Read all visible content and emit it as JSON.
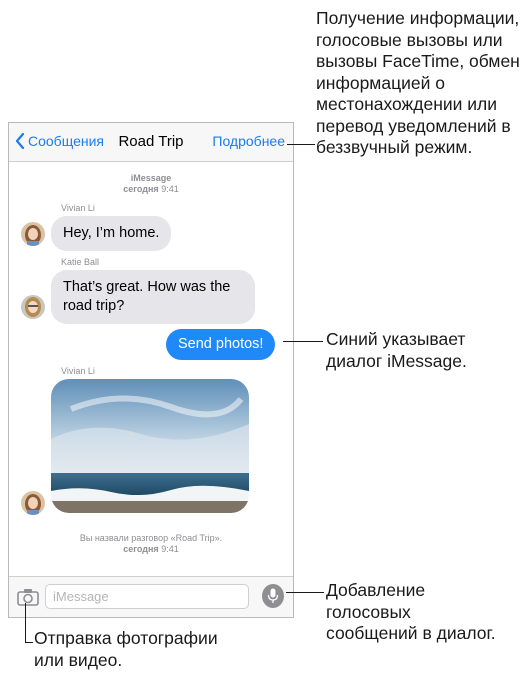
{
  "navbar": {
    "back_label": "Сообщения",
    "title": "Road Trip",
    "details_label": "Подробнее"
  },
  "conversation": {
    "header_service": "iMessage",
    "header_day": "сегодня",
    "header_time": "9:41",
    "messages": [
      {
        "sender": "Vivian Li",
        "text": "Hey, I’m home."
      },
      {
        "sender": "Katie Ball",
        "text": "That’s great. How was the road trip?"
      },
      {
        "sender": "",
        "text": "Send photos!"
      },
      {
        "sender": "Vivian Li",
        "text": ""
      }
    ],
    "footer_note": "Вы назвали разговор «Road Trip».",
    "footer_day": "сегодня",
    "footer_time": "9:41"
  },
  "input": {
    "placeholder": "iMessage"
  },
  "callouts": {
    "details": "Получение информации, голосовые вызовы или вызовы FaceTime, обмен информацией о местонахождении или перевод уведомлений в беззвучный режим.",
    "blue": "Синий указывает диалог iMessage.",
    "camera": "Отправка фотографии или видео.",
    "audio": "Добавление голосовых сообщений в диалог."
  },
  "colors": {
    "accent": "#1b7cf0",
    "imessage_bubble": "#1f8af7",
    "received_bubble": "#e5e5ea"
  },
  "icons": [
    "chevron-left-icon",
    "camera-icon",
    "microphone-icon"
  ]
}
